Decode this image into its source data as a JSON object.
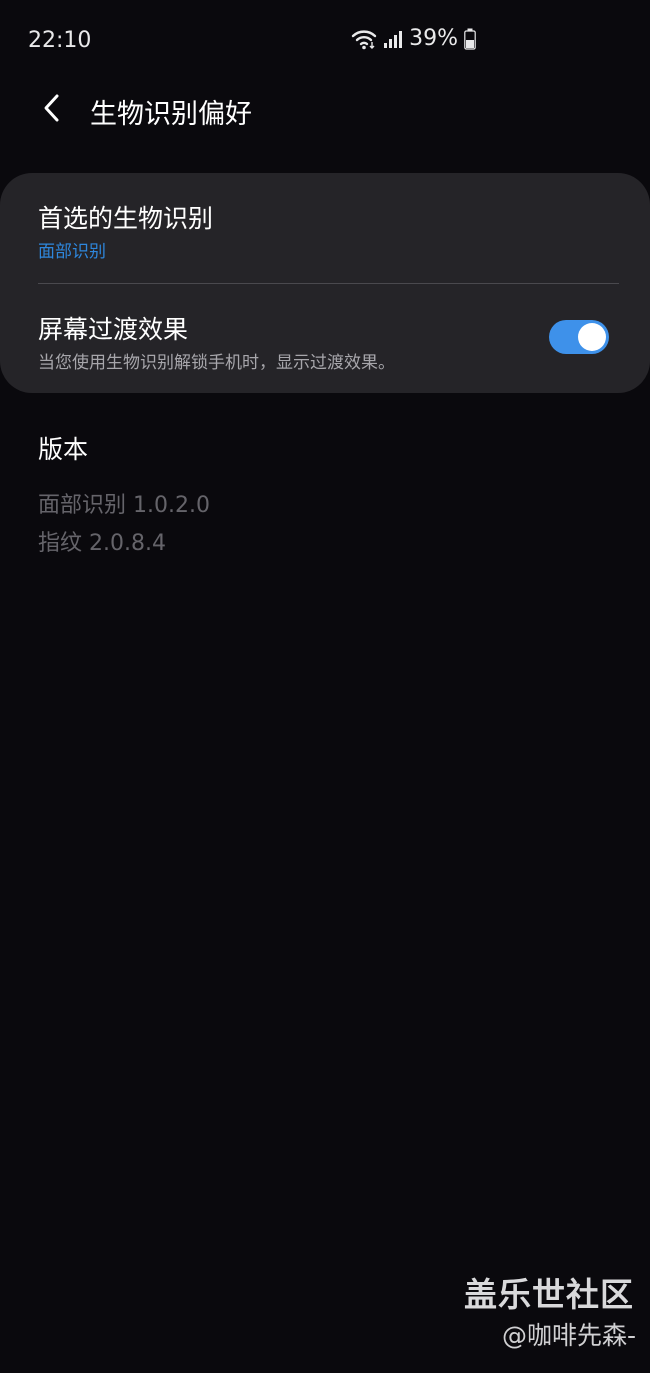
{
  "status_bar": {
    "time": "22:10",
    "battery_percent": "39%",
    "icons": [
      "wifi-icon",
      "signal-icon",
      "battery-icon"
    ]
  },
  "app_bar": {
    "back_icon": "chevron-left-icon",
    "title": "生物识别偏好"
  },
  "settings": {
    "preferred_biometric": {
      "title": "首选的生物识别",
      "value": "面部识别"
    },
    "screen_transition": {
      "title": "屏幕过渡效果",
      "description": "当您使用生物识别解锁手机时，显示过渡效果。",
      "enabled": true
    }
  },
  "version": {
    "header": "版本",
    "face_recognition": "面部识别 1.0.2.0",
    "fingerprint": "指纹 2.0.8.4"
  },
  "watermark": {
    "site": "盖乐世社区",
    "author": "@咖啡先森-"
  },
  "colors": {
    "background": "#0a090d",
    "card": "#252428",
    "accent": "#2e87dd",
    "toggle_on": "#3e91ea",
    "secondary_text": "#a7a6ab",
    "muted_text": "#65646a"
  }
}
